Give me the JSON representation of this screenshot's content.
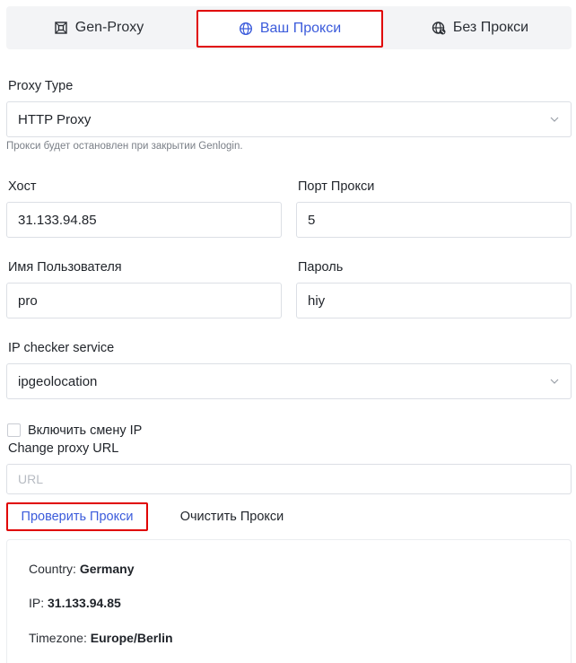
{
  "tabs": {
    "gen_proxy": "Gen-Proxy",
    "own_proxy": "Ваш Прокси",
    "no_proxy": "Без Прокси"
  },
  "proxy_type": {
    "label": "Proxy Type",
    "value": "HTTP Proxy",
    "hint": "Прокси будет остановлен при закрытии Genlogin."
  },
  "host": {
    "label": "Хост",
    "value": "31.133.94.85"
  },
  "port": {
    "label": "Порт Прокси",
    "value": "5"
  },
  "username": {
    "label": "Имя Пользователя",
    "value": "pro"
  },
  "password": {
    "label": "Пароль",
    "value": "hiy"
  },
  "ip_checker": {
    "label": "IP checker service",
    "value": "ipgeolocation"
  },
  "change_ip": {
    "label": "Включить смену IP",
    "checked": false
  },
  "change_url": {
    "label": "Change proxy URL",
    "placeholder": "URL"
  },
  "buttons": {
    "check": "Проверить Прокси",
    "clear": "Очистить Прокси"
  },
  "result": {
    "country_label": "Country:",
    "country_value": "Germany",
    "ip_label": "IP:",
    "ip_value": "31.133.94.85",
    "timezone_label": "Timezone:",
    "timezone_value": "Europe/Berlin"
  },
  "colors": {
    "accent": "#3b5bdb",
    "highlight": "#e00000"
  }
}
